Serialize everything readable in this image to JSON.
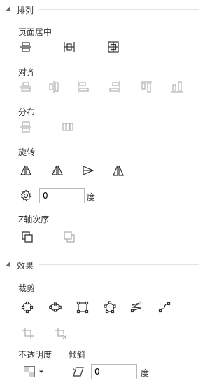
{
  "arrange": {
    "title": "排列",
    "page_center": {
      "label": "页面居中"
    },
    "align": {
      "label": "对齐"
    },
    "distribute": {
      "label": "分布"
    },
    "rotate": {
      "label": "旋转",
      "angle_value": "0",
      "unit": "度"
    },
    "zorder": {
      "label": "Z轴次序"
    }
  },
  "effects": {
    "title": "效果",
    "crop": {
      "label": "裁剪"
    },
    "opacity": {
      "label": "不透明度"
    },
    "skew": {
      "label": "倾斜",
      "value": "0",
      "unit": "度"
    }
  }
}
